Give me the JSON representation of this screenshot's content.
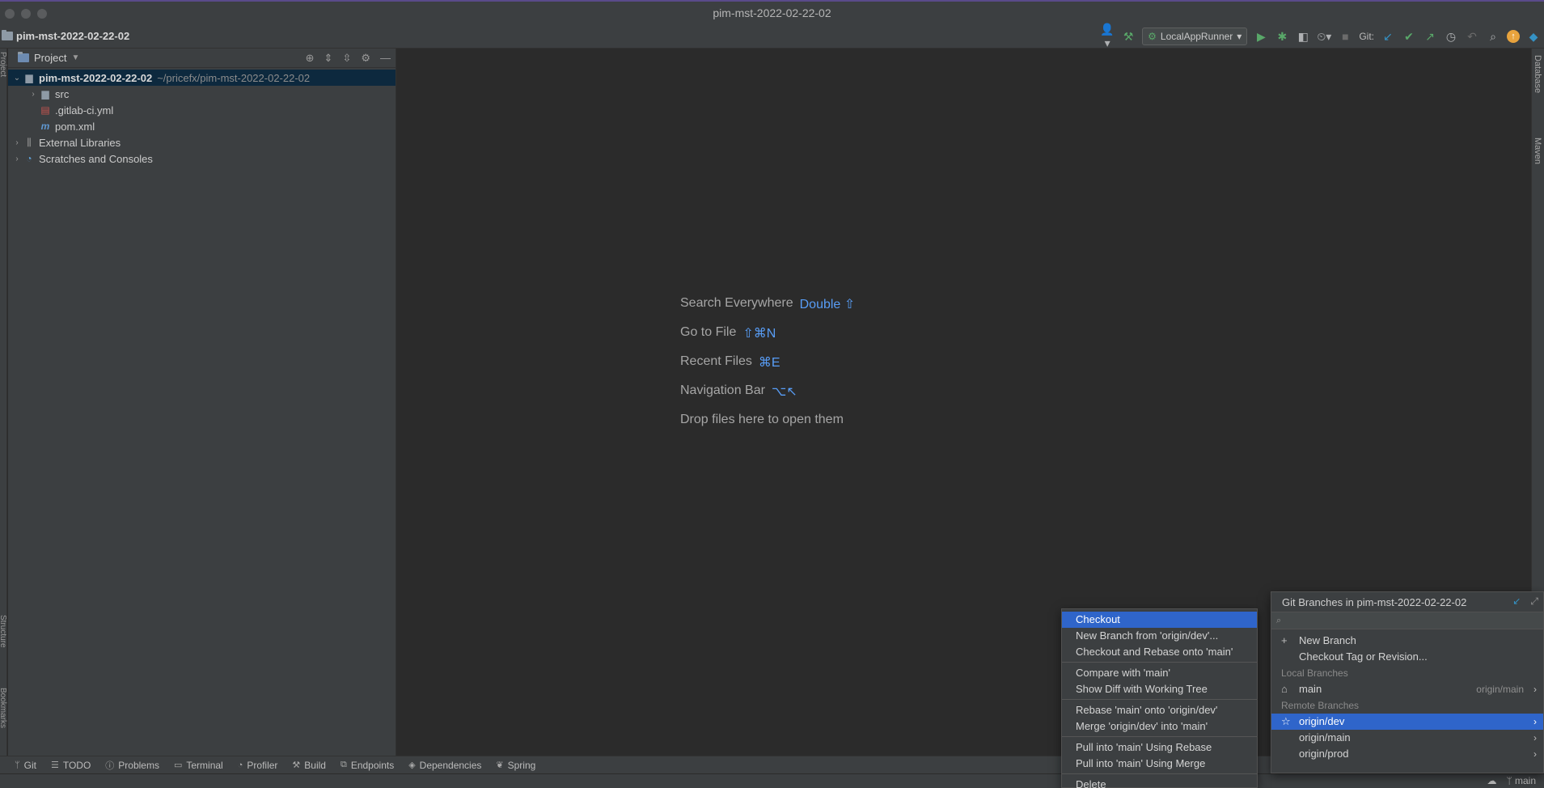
{
  "window": {
    "title": "pim-mst-2022-02-22-02"
  },
  "navbar": {
    "project_name": "pim-mst-2022-02-22-02",
    "run_config": "LocalAppRunner",
    "git_label": "Git:"
  },
  "left_strip": {
    "project_label": "Project",
    "structure_label": "Structure",
    "bookmarks_label": "Bookmarks"
  },
  "project_panel": {
    "title": "Project",
    "tree": {
      "root": {
        "name": "pim-mst-2022-02-22-02",
        "path": "~/pricefx/pim-mst-2022-02-22-02"
      },
      "src": "src",
      "gitlab": ".gitlab-ci.yml",
      "pom": "pom.xml",
      "ext_libs": "External Libraries",
      "scratches": "Scratches and Consoles"
    }
  },
  "editor": {
    "hints": [
      {
        "label": "Search Everywhere",
        "key": "Double ⇧"
      },
      {
        "label": "Go to File",
        "key": "⇧⌘N"
      },
      {
        "label": "Recent Files",
        "key": "⌘E"
      },
      {
        "label": "Navigation Bar",
        "key": "⌥↖"
      },
      {
        "label": "Drop files here to open them",
        "key": ""
      }
    ]
  },
  "right_strip": {
    "database": "Database",
    "maven": "Maven"
  },
  "bottom_bar": {
    "git": "Git",
    "todo": "TODO",
    "problems": "Problems",
    "terminal": "Terminal",
    "profiler": "Profiler",
    "build": "Build",
    "endpoints": "Endpoints",
    "dependencies": "Dependencies",
    "spring": "Spring"
  },
  "status_bar": {
    "branch": "main"
  },
  "context_menu": {
    "items": [
      "Checkout",
      "New Branch from 'origin/dev'...",
      "Checkout and Rebase onto 'main'",
      "Compare with 'main'",
      "Show Diff with Working Tree",
      "Rebase 'main' onto 'origin/dev'",
      "Merge 'origin/dev' into 'main'",
      "Pull into 'main' Using Rebase",
      "Pull into 'main' Using Merge",
      "Delete"
    ]
  },
  "branches_popup": {
    "title": "Git Branches in pim-mst-2022-02-22-02",
    "new_branch": "New Branch",
    "checkout_tag": "Checkout Tag or Revision...",
    "local_header": "Local Branches",
    "local": [
      {
        "name": "main",
        "tracking": "origin/main"
      }
    ],
    "remote_header": "Remote Branches",
    "remote": [
      "origin/dev",
      "origin/main",
      "origin/prod"
    ]
  }
}
